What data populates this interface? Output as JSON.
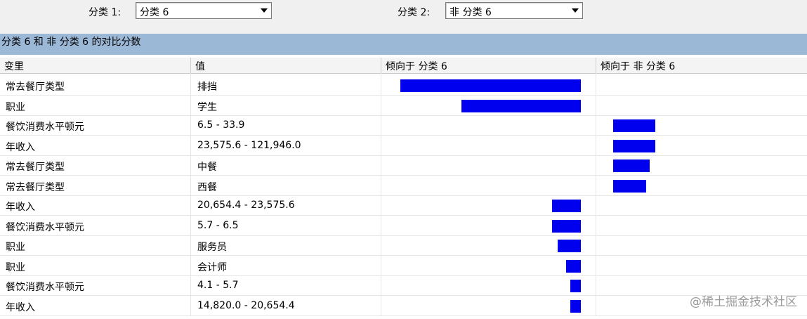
{
  "selectors": {
    "cat1_label": "分类 1:",
    "cat1_value": "分类 6",
    "cat2_label": "分类 2:",
    "cat2_value": "非 分类 6"
  },
  "panel_title": "分类 6 和 非 分类 6 的对比分数",
  "columns": {
    "variable": "变里",
    "value": "值",
    "favor_a": "倾向于 分类 6",
    "favor_b": "倾向于 非 分类 6"
  },
  "rows": [
    {
      "variable": "常去餐厅类型",
      "value": "排挡",
      "side": "a",
      "score": 1.0
    },
    {
      "variable": "职业",
      "value": "学生",
      "side": "a",
      "score": 0.66
    },
    {
      "variable": "餐饮消费水平顿元",
      "value": "6.5 - 33.9",
      "side": "b",
      "score": 0.23
    },
    {
      "variable": "年收入",
      "value": "23,575.6 - 121,946.0",
      "side": "b",
      "score": 0.23
    },
    {
      "variable": "常去餐厅类型",
      "value": "中餐",
      "side": "b",
      "score": 0.2
    },
    {
      "variable": "常去餐厅类型",
      "value": "西餐",
      "side": "b",
      "score": 0.18
    },
    {
      "variable": "年收入",
      "value": "20,654.4 - 23,575.6",
      "side": "a",
      "score": 0.16
    },
    {
      "variable": "餐饮消费水平顿元",
      "value": "5.7 - 6.5",
      "side": "a",
      "score": 0.16
    },
    {
      "variable": "职业",
      "value": "服务员",
      "side": "a",
      "score": 0.13
    },
    {
      "variable": "职业",
      "value": "会计师",
      "side": "a",
      "score": 0.08
    },
    {
      "variable": "餐饮消费水平顿元",
      "value": "4.1 - 5.7",
      "side": "a",
      "score": 0.06
    },
    {
      "variable": "年收入",
      "value": "14,820.0 - 20,654.4",
      "side": "a",
      "score": 0.06
    }
  ],
  "colors": {
    "bar": "#0000ee",
    "title_bg": "#9cb8d7"
  },
  "watermark": "@稀土掘金技术社区"
}
